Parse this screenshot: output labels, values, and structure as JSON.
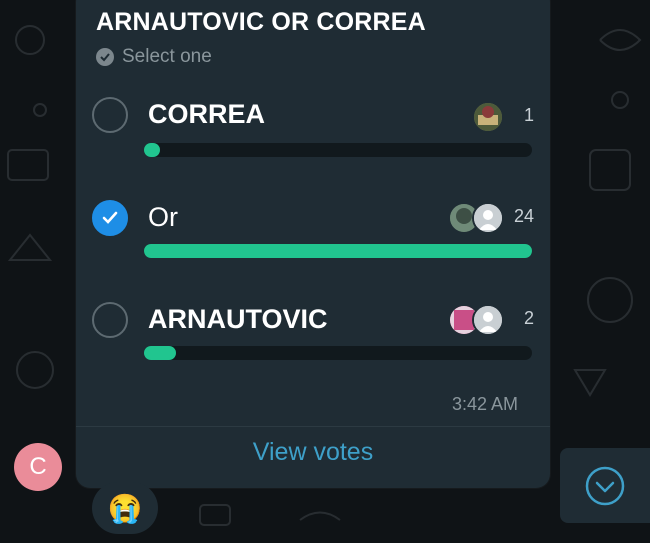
{
  "poll": {
    "title": "ARNAUTOVIC OR CORREA",
    "select_hint": "Select one",
    "options": [
      {
        "label": "CORREA",
        "votes": "1",
        "selected": false,
        "fraction": 0.04
      },
      {
        "label": "Or",
        "votes": "24",
        "selected": true,
        "fraction": 1.0
      },
      {
        "label": "ARNAUTOVIC",
        "votes": "2",
        "selected": false,
        "fraction": 0.08
      }
    ],
    "timestamp": "3:42 AM",
    "view_votes_label": "View votes"
  },
  "sender": {
    "initial": "C",
    "avatar_color": "#ea8c99"
  },
  "reaction": {
    "emoji": "😭"
  },
  "colors": {
    "accent_fill": "#21c58f",
    "checked": "#1e8ee6",
    "link": "#3ea0c9",
    "bubble": "#1f2c34"
  },
  "icons": {
    "hint": "check-circle-icon",
    "scroll": "chevron-down-circle-icon"
  }
}
